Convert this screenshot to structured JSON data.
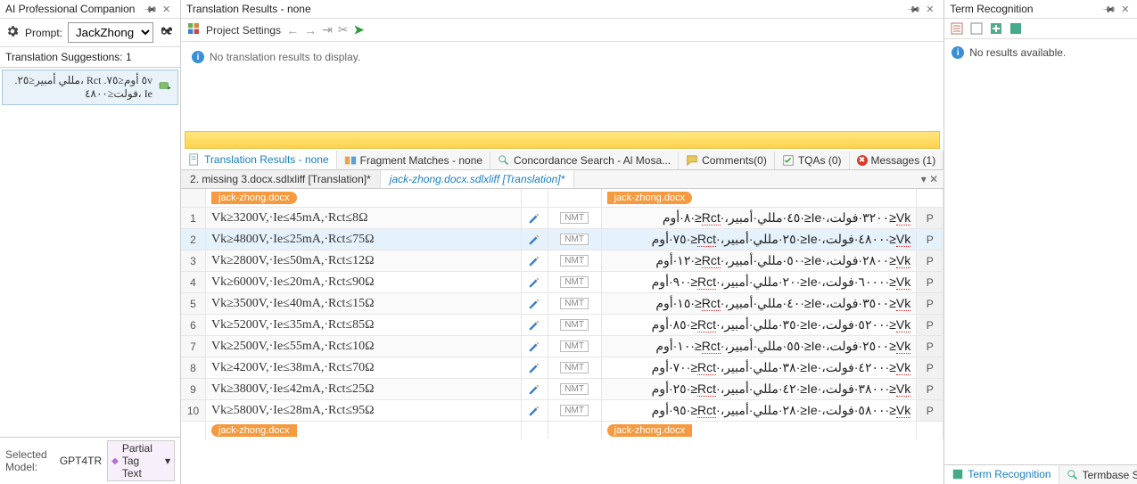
{
  "ai_panel": {
    "title": "AI Professional Companion",
    "prompt_label": "Prompt:",
    "prompt_value": "JackZhong",
    "sugg_header": "Translation Suggestions: 1",
    "sugg_text": "٥v أوم≤٧٥. Rct ،مللي أمبير≤٢٥. Ie ،فولت≤٤٨٠٠"
  },
  "footer": {
    "model_label": "Selected Model:",
    "model_value": "GPT4TR",
    "tag_mode": "Partial Tag Text"
  },
  "tr_panel": {
    "title": "Translation Results - none",
    "proj_settings": "Project Settings",
    "no_results": "No translation results to display."
  },
  "tabs_mid": {
    "t1": "Translation Results - none",
    "t2": "Fragment Matches - none",
    "t3": "Concordance Search - Al Mosa...",
    "t4": "Comments(0)",
    "t5": "TQAs (0)",
    "t6": "Messages (1)"
  },
  "doc_tabs": {
    "d1": "2. missing 3.docx.sdlxliff [Translation]*",
    "d2": "jack-zhong.docx.sdlxliff [Translation]*"
  },
  "crumb": "jack-zhong.docx",
  "segments": [
    {
      "n": "1",
      "src": "Vk≥3200V,·Ie≤45mA,·Rct≤8Ω",
      "tgt": "Vk≤٣٢٠٠·فولت،·Ie≤·٤٥·مللي·أمبير،·Rct≤·٨·أوم"
    },
    {
      "n": "2",
      "src": "Vk≥4800V,·Ie≤25mA,·Rct≤75Ω",
      "tgt": "Vk≤·٤٨٠٠·فولت،·Ie≤·٢٥·مللي·أمبير،·Rct≤·٧٥·أوم"
    },
    {
      "n": "3",
      "src": "Vk≥2800V,·Ie≤50mA,·Rct≤12Ω",
      "tgt": "Vk≤٢٨٠٠·فولت،·Ie≤·٥٠·مللي·أمبير،·Rct≤·١٢·أوم"
    },
    {
      "n": "4",
      "src": "Vk≥6000V,·Ie≤20mA,·Rct≤90Ω",
      "tgt": "Vk≤·٦٠٠٠·فولت،·Ie≤·٢٠·مللي·أمبير،·Rct≤·٩٠·أوم"
    },
    {
      "n": "5",
      "src": "Vk≥3500V,·Ie≤40mA,·Rct≤15Ω",
      "tgt": "Vk≤٣٥٠٠·فولت،·Ie≤·٤٠·مللي·أمبير،·Rct≤·١٥·أوم"
    },
    {
      "n": "6",
      "src": "Vk≥5200V,·Ie≤35mA,·Rct≤85Ω",
      "tgt": "Vk≤·٥٢٠٠·فولت،·Ie≤·٣٥·مللي·أمبير،·Rct≤·٨٥·أوم"
    },
    {
      "n": "7",
      "src": "Vk≥2500V,·Ie≤55mA,·Rct≤10Ω",
      "tgt": "Vk≤٢٥٠٠·فولت،·Ie≤·٥٥·مللي·أمبير،·Rct≤·١٠·أوم"
    },
    {
      "n": "8",
      "src": "Vk≥4200V,·Ie≤38mA,·Rct≤70Ω",
      "tgt": "Vk≤·٤٢٠٠·فولت،·Ie≤·٣٨·مللي·أمبير،·Rct≤·٧٠·أوم"
    },
    {
      "n": "9",
      "src": "Vk≥3800V,·Ie≤42mA,·Rct≤25Ω",
      "tgt": "Vk≤·٣٨٠٠·فولت،·Ie≤·٤٢·مللي·أمبير،·Rct≤·٢٥·أوم"
    },
    {
      "n": "10",
      "src": "Vk≥5800V,·Ie≤28mA,·Rct≤95Ω",
      "tgt": "Vk≤·٥٨٠٠·فولت،·Ie≤·٢٨·مللي·أمبير،·Rct≤·٩٥·أوم"
    }
  ],
  "nmt": "NMT",
  "pflag": "P",
  "term_panel": {
    "title": "Term Recognition",
    "no_results": "No results available."
  },
  "far_tabs": {
    "t1": "Term Recognition",
    "t2": "Termbase Search"
  }
}
